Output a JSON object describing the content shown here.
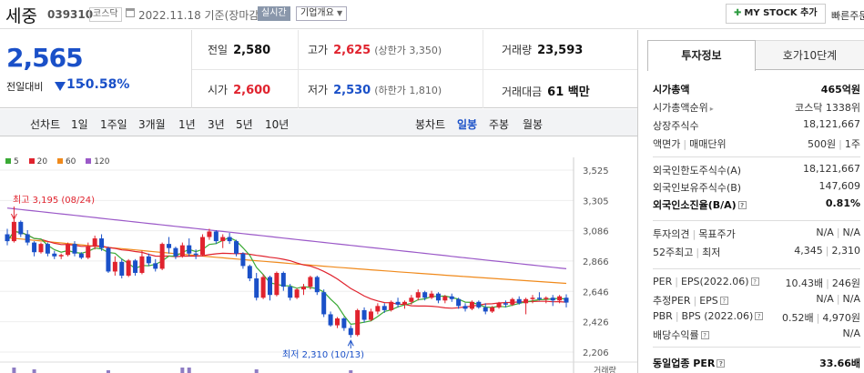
{
  "header": {
    "name": "세중",
    "code": "039310",
    "market": "코스닥",
    "date": "2022.11.18  기준(장마감)",
    "realtime": "실시간",
    "corp_info": "기업개요",
    "mystock": "MY STOCK 추가",
    "quick": "빠른주문"
  },
  "summary": {
    "current": "2,565",
    "change_label": "전일대비",
    "change_value": "15",
    "change_pct": "-0.58%",
    "prev_label": "전일",
    "prev": "2,580",
    "high_label": "고가",
    "high": "2,625",
    "upper_limit": "(상한가 3,350)",
    "volume_label": "거래량",
    "volume": "23,593",
    "open_label": "시가",
    "open": "2,600",
    "low_label": "저가",
    "low": "2,530",
    "lower_limit": "(하한가 1,810)",
    "amount_label": "거래대금",
    "amount": "61 백만"
  },
  "tabs": {
    "line_chart": "선차트",
    "periods": [
      "1일",
      "1주일",
      "3개월",
      "1년",
      "3년",
      "5년",
      "10년"
    ],
    "candle_chart": "봉차트",
    "candle_periods": [
      "일봉",
      "주봉",
      "월봉"
    ]
  },
  "chart_data": {
    "type": "candlestick",
    "legend": [
      {
        "name": "5",
        "color": "#3aaa35"
      },
      {
        "name": "20",
        "color": "#e0232e"
      },
      {
        "name": "60",
        "color": "#f08a1c"
      },
      {
        "name": "120",
        "color": "#9b59c8"
      }
    ],
    "y_ticks": [
      "3,525",
      "3,305",
      "3,086",
      "2,866",
      "2,646",
      "2,426",
      "2,206"
    ],
    "ylim": [
      2206,
      3525
    ],
    "high_annotation": "최고 3,195 (08/24)",
    "low_annotation": "최저 2,310 (10/13)",
    "volume_label": "거래량",
    "candles": [
      [
        3060,
        3100,
        2980,
        3010
      ],
      [
        3010,
        3195,
        3000,
        3150
      ],
      [
        3150,
        3160,
        3040,
        3060
      ],
      [
        3060,
        3090,
        2980,
        3000
      ],
      [
        3000,
        3010,
        2900,
        2930
      ],
      [
        2930,
        3000,
        2920,
        2990
      ],
      [
        2990,
        3000,
        2900,
        2920
      ],
      [
        2920,
        2940,
        2880,
        2900
      ],
      [
        2900,
        2920,
        2880,
        2910
      ],
      [
        2910,
        3000,
        2900,
        2990
      ],
      [
        2990,
        3010,
        2900,
        2920
      ],
      [
        2920,
        2930,
        2880,
        2890
      ],
      [
        2890,
        3000,
        2880,
        2970
      ],
      [
        2970,
        3050,
        2950,
        3030
      ],
      [
        3030,
        3060,
        2940,
        2960
      ],
      [
        2960,
        2970,
        2780,
        2790
      ],
      [
        2790,
        2900,
        2760,
        2860
      ],
      [
        2860,
        2880,
        2740,
        2760
      ],
      [
        2760,
        2880,
        2750,
        2870
      ],
      [
        2870,
        2880,
        2760,
        2780
      ],
      [
        2780,
        2940,
        2770,
        2900
      ],
      [
        2900,
        2920,
        2830,
        2850
      ],
      [
        2850,
        2880,
        2790,
        2810
      ],
      [
        2810,
        3000,
        2800,
        2990
      ],
      [
        2990,
        3040,
        2920,
        2960
      ],
      [
        2960,
        2970,
        2880,
        2900
      ],
      [
        2900,
        3000,
        2890,
        2980
      ],
      [
        2980,
        3030,
        2900,
        2920
      ],
      [
        2920,
        2950,
        2880,
        2910
      ],
      [
        2910,
        3060,
        2900,
        3040
      ],
      [
        3040,
        3100,
        3020,
        3080
      ],
      [
        3080,
        3090,
        2990,
        3010
      ],
      [
        3010,
        3060,
        2960,
        3040
      ],
      [
        3040,
        3070,
        2990,
        3010
      ],
      [
        3010,
        3020,
        2900,
        2920
      ],
      [
        2920,
        2930,
        2810,
        2830
      ],
      [
        2830,
        2840,
        2720,
        2740
      ],
      [
        2740,
        2780,
        2580,
        2600
      ],
      [
        2600,
        2770,
        2590,
        2750
      ],
      [
        2750,
        2760,
        2580,
        2620
      ],
      [
        2620,
        2790,
        2610,
        2780
      ],
      [
        2780,
        2790,
        2650,
        2680
      ],
      [
        2680,
        2700,
        2580,
        2600
      ],
      [
        2600,
        2670,
        2590,
        2660
      ],
      [
        2660,
        2700,
        2620,
        2680
      ],
      [
        2680,
        2760,
        2660,
        2750
      ],
      [
        2750,
        2760,
        2620,
        2640
      ],
      [
        2640,
        2660,
        2460,
        2480
      ],
      [
        2480,
        2500,
        2390,
        2400
      ],
      [
        2400,
        2460,
        2380,
        2450
      ],
      [
        2450,
        2460,
        2360,
        2380
      ],
      [
        2380,
        2400,
        2310,
        2330
      ],
      [
        2330,
        2520,
        2320,
        2510
      ],
      [
        2510,
        2530,
        2420,
        2440
      ],
      [
        2440,
        2520,
        2430,
        2500
      ],
      [
        2500,
        2560,
        2480,
        2540
      ],
      [
        2540,
        2560,
        2490,
        2510
      ],
      [
        2510,
        2580,
        2500,
        2570
      ],
      [
        2570,
        2600,
        2530,
        2550
      ],
      [
        2550,
        2580,
        2520,
        2570
      ],
      [
        2570,
        2620,
        2550,
        2600
      ],
      [
        2600,
        2660,
        2580,
        2640
      ],
      [
        2640,
        2650,
        2580,
        2600
      ],
      [
        2600,
        2650,
        2590,
        2630
      ],
      [
        2630,
        2640,
        2560,
        2580
      ],
      [
        2580,
        2620,
        2560,
        2610
      ],
      [
        2610,
        2630,
        2570,
        2590
      ],
      [
        2590,
        2600,
        2520,
        2540
      ],
      [
        2540,
        2560,
        2500,
        2520
      ],
      [
        2520,
        2580,
        2510,
        2570
      ],
      [
        2570,
        2580,
        2520,
        2530
      ],
      [
        2530,
        2560,
        2480,
        2500
      ],
      [
        2500,
        2540,
        2490,
        2530
      ],
      [
        2530,
        2570,
        2520,
        2560
      ],
      [
        2560,
        2580,
        2530,
        2550
      ],
      [
        2550,
        2600,
        2540,
        2590
      ],
      [
        2590,
        2610,
        2550,
        2560
      ],
      [
        2560,
        2600,
        2480,
        2590
      ],
      [
        2590,
        2620,
        2560,
        2600
      ],
      [
        2600,
        2640,
        2580,
        2590
      ],
      [
        2590,
        2610,
        2560,
        2600
      ],
      [
        2600,
        2620,
        2540,
        2580
      ],
      [
        2580,
        2620,
        2560,
        2610
      ],
      [
        2600,
        2625,
        2530,
        2565
      ]
    ]
  },
  "invest": {
    "tab_info": "투자정보",
    "tab_orderbook": "호가10단계",
    "rows1": [
      {
        "l": "시가총액",
        "r": "465억원",
        "bold": true
      },
      {
        "l": "시가총액순위",
        "r": "코스닥 1338위",
        "arrow": true
      },
      {
        "l": "상장주식수",
        "r": "18,121,667"
      },
      {
        "l": "액면가 | 매매단위",
        "r": "500원 | 1주"
      }
    ],
    "rows2": [
      {
        "l": "외국인한도주식수(A)",
        "r": "18,121,667"
      },
      {
        "l": "외국인보유주식수(B)",
        "r": "147,609"
      },
      {
        "l": "외국인소진율(B/A)",
        "r": "0.81%",
        "bold": true,
        "q": true
      }
    ],
    "rows3": [
      {
        "l": "투자의견 | 목표주가",
        "r": "N/A | N/A"
      },
      {
        "l": "52주최고 | 최저",
        "r": "4,345 | 2,310"
      }
    ],
    "rows4": [
      {
        "l": "PER | EPS(2022.06)",
        "r": "10.43배 | 246원",
        "q": true
      },
      {
        "l": "추정PER | EPS",
        "r": "N/A | N/A",
        "q": true
      },
      {
        "l": "PBR | BPS (2022.06)",
        "r": "0.52배 | 4,970원",
        "q": true
      },
      {
        "l": "배당수익률",
        "r": "N/A",
        "q": true
      }
    ],
    "peer_per_label": "동일업종 PER",
    "peer_per": "33.66배"
  }
}
